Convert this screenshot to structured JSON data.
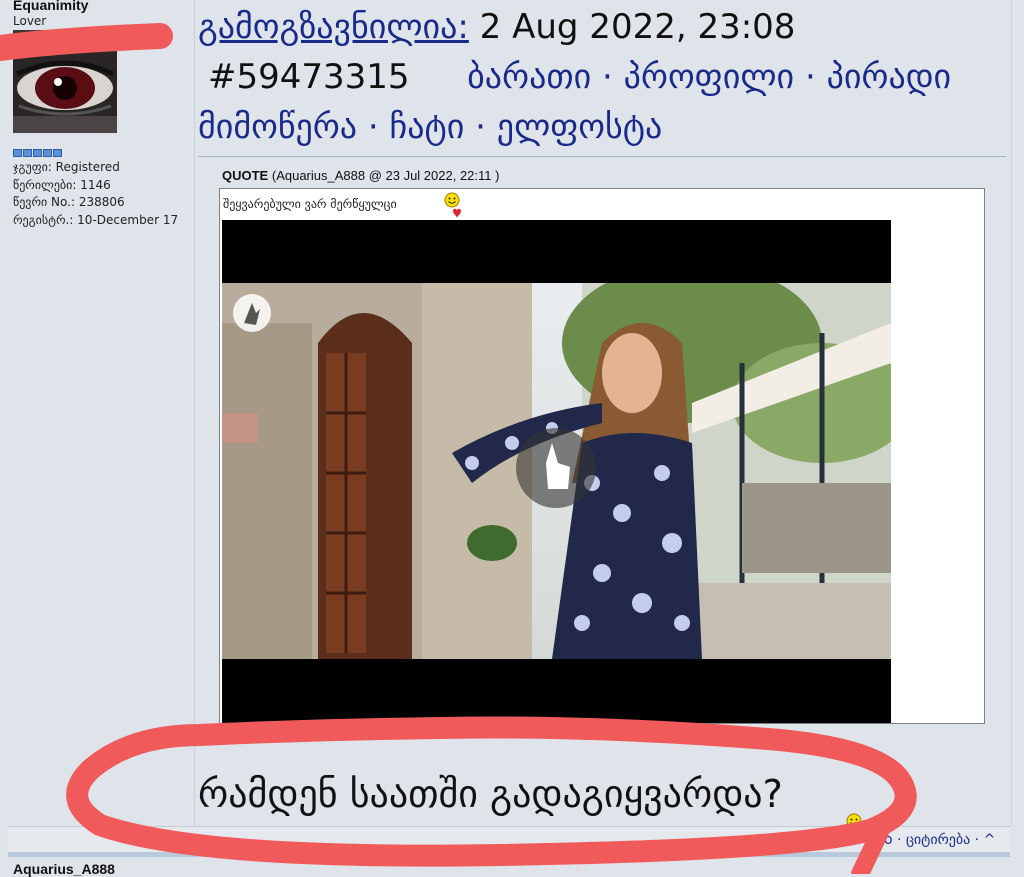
{
  "author": {
    "name": "Equanimity",
    "rank": "Lover",
    "pips": 5,
    "group": "ჯგუფი: Registered",
    "posts": "წერილები: 1146",
    "member_no": "წევრი No.: 238806",
    "registered": "რეგისტრ.: 10-December 17"
  },
  "post": {
    "posted_label": "გამოგზავნილია:",
    "date": "2 Aug 2022, 23:08",
    "id": "#59473315",
    "links": [
      "ბარათი",
      "პროფილი",
      "პირადი",
      "მიმოწერა",
      "ჩატი",
      "ელფოსტა"
    ],
    "separator": "·"
  },
  "quote": {
    "label": "QUOTE",
    "meta": "(Aquarius_A888 @ 23 Jul 2022, 22:11 )",
    "text": "შეყვარებული ვარ მერწყულცი"
  },
  "reply": {
    "text": "რამდენ საათში გადაგიყვარდა?"
  },
  "footer": {
    "action_sep": "·",
    "quote_action": "ციტირება",
    "top_action": "^",
    "truncated_action": "o"
  },
  "next_post": {
    "author": "Aquarius_A888"
  },
  "colors": {
    "link": "#1a2a8a",
    "background": "#dfe4ea",
    "annotation": "#f05a5a"
  }
}
